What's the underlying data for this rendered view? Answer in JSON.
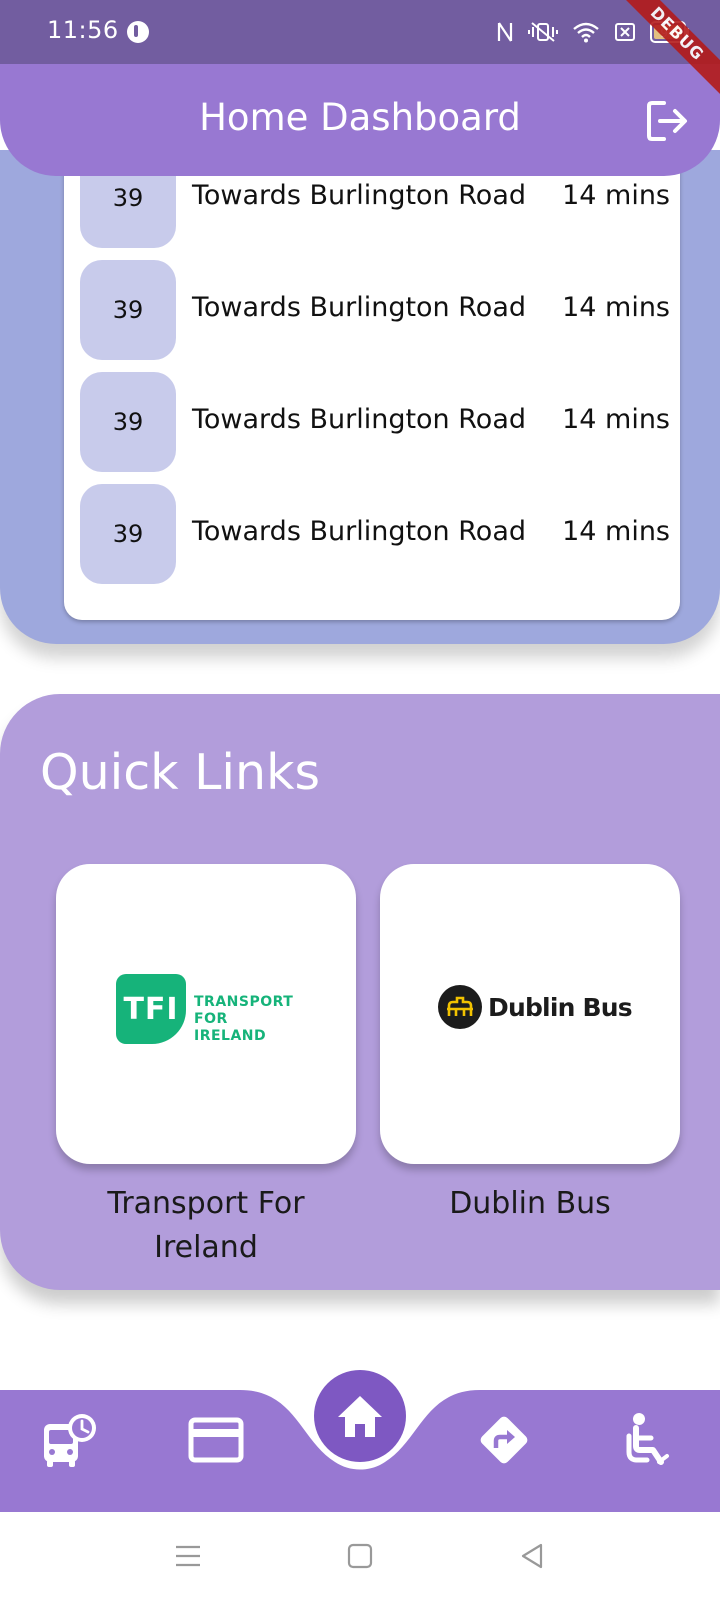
{
  "status_bar": {
    "time": "11:56",
    "battery": "94",
    "debug_banner": "DEBUG"
  },
  "app_bar": {
    "title": "Home Dashboard",
    "logout_icon": "logout-icon"
  },
  "departures": [
    {
      "route": "39",
      "destination": "Towards Burlington Road",
      "eta": "14 mins"
    },
    {
      "route": "39",
      "destination": "Towards Burlington Road",
      "eta": "14 mins"
    },
    {
      "route": "39",
      "destination": "Towards Burlington Road",
      "eta": "14 mins"
    },
    {
      "route": "39",
      "destination": "Towards Burlington Road",
      "eta": "14 mins"
    }
  ],
  "quick_links": {
    "title": "Quick Links",
    "items": [
      {
        "label": "Transport For Ireland",
        "logo_mark": "TFI",
        "logo_lines": [
          "TRANSPORT",
          "FOR",
          "IRELAND"
        ]
      },
      {
        "label": "Dublin Bus",
        "logo_text": "Dublin Bus"
      }
    ]
  },
  "bottom_nav": {
    "items": [
      "bus-schedule-icon",
      "card-icon",
      "home-icon",
      "directions-icon",
      "accessibility-icon"
    ],
    "active": "home-icon"
  },
  "colors": {
    "status_bar": "#725da0",
    "app_bar": "#9878d2",
    "departures_bg": "#9ea8dd",
    "route_badge": "#c8cbeb",
    "quick_links_bg": "#b29ddb",
    "nav_bg": "#9878d2",
    "home_button": "#7e58c2",
    "tfi_green": "#16b37a"
  }
}
